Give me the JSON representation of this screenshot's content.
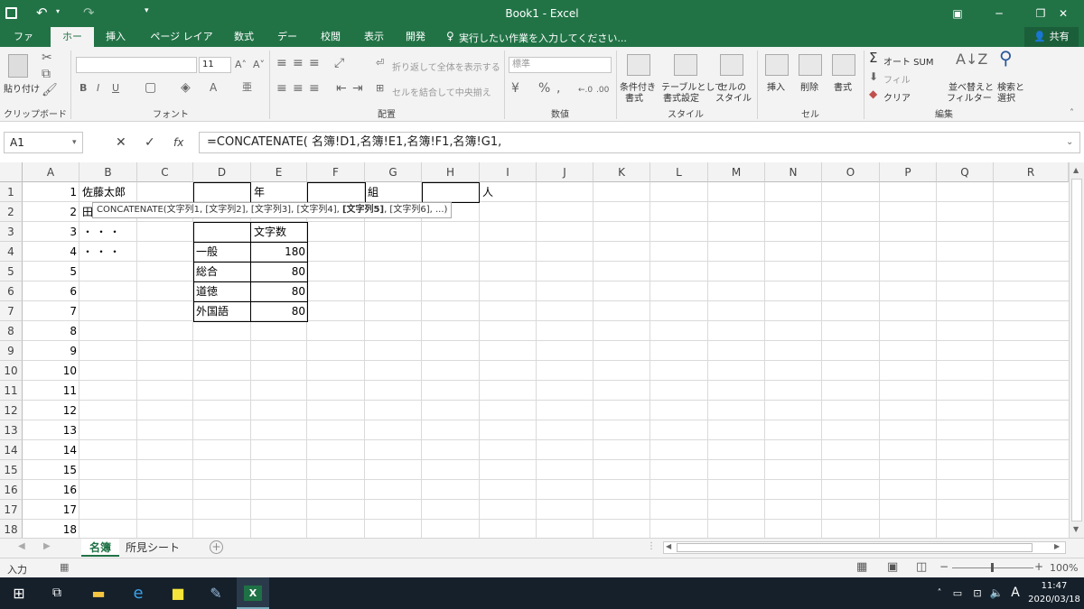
{
  "title_bar": {
    "title": "Book1  -  Excel",
    "undo_icon": "undo-icon",
    "redo_icon": "redo-icon",
    "save_icon": "save-icon"
  },
  "tabs": [
    {
      "label": "ファイル",
      "active": false
    },
    {
      "label": "ホーム",
      "active": true
    },
    {
      "label": "挿入",
      "active": false
    },
    {
      "label": "ページ レイアウト",
      "active": false
    },
    {
      "label": "数式",
      "active": false
    },
    {
      "label": "データ",
      "active": false
    },
    {
      "label": "校閲",
      "active": false
    },
    {
      "label": "表示",
      "active": false
    },
    {
      "label": "開発",
      "active": false
    }
  ],
  "tell_me": "実行したい作業を入力してください...",
  "share": "共有",
  "ribbon": {
    "clipboard": {
      "paste": "貼り付け",
      "group": "クリップボード"
    },
    "font": {
      "size": "11",
      "group": "フォント"
    },
    "alignment": {
      "wrap": "折り返して全体を表示する",
      "merge": "セルを結合して中央揃え",
      "group": "配置"
    },
    "number": {
      "format": "標準",
      "group": "数値"
    },
    "styles": {
      "conditional_1": "条件付き",
      "conditional_2": "書式",
      "table_1": "テーブルとして",
      "table_2": "書式設定",
      "cell_1": "セルの",
      "cell_2": "スタイル",
      "group": "スタイル"
    },
    "cells": {
      "insert": "挿入",
      "delete": "削除",
      "format": "書式",
      "group": "セル"
    },
    "editing": {
      "autosum": "オート SUM",
      "fill": "フィル",
      "clear": "クリア",
      "sort_1": "並べ替えと",
      "sort_2": "フィルター",
      "find_1": "検索と",
      "find_2": "選択",
      "group": "編集"
    }
  },
  "formula_bar": {
    "name_box": "A1",
    "formula": "=CONCATENATE( 名簿!D1,名簿!E1,名簿!F1,名簿!G1,",
    "tooltip_prefix": "CONCATENATE(文字列1, [文字列2], [文字列3], [文字列4], ",
    "tooltip_bold": "[文字列5]",
    "tooltip_suffix": ", [文字列6], ...)"
  },
  "columns": [
    "A",
    "B",
    "C",
    "D",
    "E",
    "F",
    "G",
    "H",
    "I",
    "J",
    "K",
    "L",
    "M",
    "N",
    "O",
    "P",
    "Q",
    "R"
  ],
  "rows": [
    "1",
    "2",
    "3",
    "4",
    "5",
    "6",
    "7",
    "8",
    "9",
    "10",
    "11",
    "12",
    "13",
    "14",
    "15",
    "16",
    "17",
    "18"
  ],
  "cells": {
    "A": [
      "1",
      "2",
      "3",
      "4",
      "5",
      "6",
      "7",
      "8",
      "9",
      "10",
      "11",
      "12",
      "13",
      "14",
      "15",
      "16",
      "17",
      "18"
    ],
    "B1": "佐藤太郎",
    "B2": "田",
    "B3": "・・・",
    "B4": "・・・",
    "E1": "年",
    "G1": "組",
    "I1": "人",
    "E3": "文字数",
    "D4": "一般",
    "E4": "180",
    "D5": "総合",
    "E5": "80",
    "D6": "道徳",
    "E6": "80",
    "D7": "外国語",
    "E7": "80"
  },
  "sheets": [
    {
      "label": "名簿",
      "active": true
    },
    {
      "label": "所見シート",
      "active": false
    }
  ],
  "status": {
    "mode": "入力",
    "zoom": "100%"
  },
  "taskbar": {
    "time": "11:47",
    "date": "2020/03/18",
    "ime": "A"
  }
}
